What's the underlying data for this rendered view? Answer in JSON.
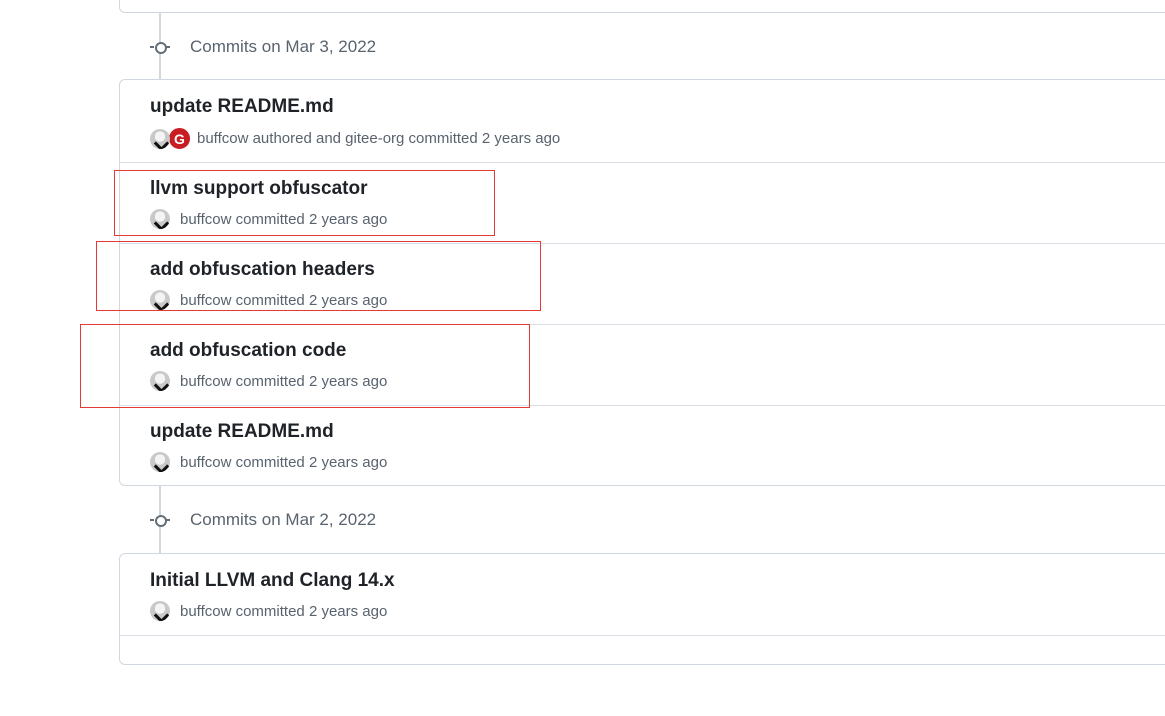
{
  "groups": [
    {
      "label": "Commits on Mar 3, 2022",
      "commits": [
        {
          "message": "update README.md",
          "meta": "buffcow authored and gitee-org committed 2 years ago",
          "gitee": true
        },
        {
          "message": "llvm support obfuscator",
          "meta": "buffcow committed 2 years ago"
        },
        {
          "message": "add obfuscation headers",
          "meta": "buffcow committed 2 years ago"
        },
        {
          "message": "add obfuscation code",
          "meta": "buffcow committed 2 years ago"
        },
        {
          "message": "update README.md",
          "meta": "buffcow committed 2 years ago"
        }
      ]
    },
    {
      "label": "Commits on Mar 2, 2022",
      "commits": [
        {
          "message": "Initial LLVM and Clang 14.x",
          "meta": "buffcow committed 2 years ago"
        }
      ]
    }
  ],
  "gitee_badge": "G",
  "colors": {
    "highlight": "#e53935",
    "border": "#d0d7de",
    "muted": "#59636e",
    "gitee": "#c71d23"
  }
}
